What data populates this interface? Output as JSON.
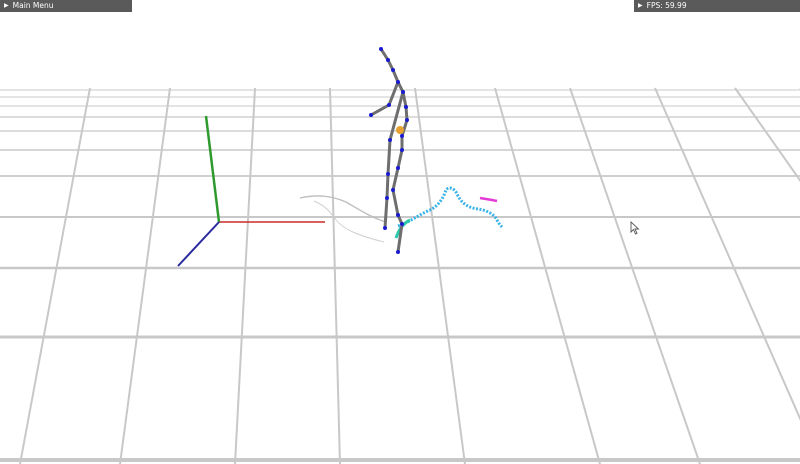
{
  "menu": {
    "label": "Main Menu",
    "icon": "triangle-right-icon"
  },
  "fps": {
    "label": "FPS: 59.99",
    "icon": "triangle-right-icon"
  },
  "colors": {
    "background": "#ffffff",
    "grid": "#c8c8c8",
    "axis_x": "#cc2a2a",
    "axis_y": "#2e9a2e",
    "axis_z": "#2a2aa0",
    "bone": "#6e6e6e",
    "joint": "#1a1ad0",
    "trail_cyan": "#3ab4e6",
    "trail_magenta": "#e43ad6",
    "root_marker": "#e8a030",
    "panel": "#5a5a5a"
  }
}
